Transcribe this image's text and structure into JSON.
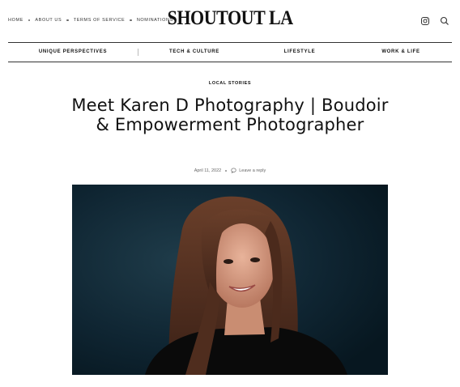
{
  "topnav": {
    "items": [
      "HOME",
      "ABOUT US",
      "TERMS OF SERVICE",
      "NOMINATIONS"
    ]
  },
  "logo": {
    "text": "SHOUTOUT LA"
  },
  "icons": {
    "social": "instagram-icon",
    "search": "search-icon",
    "comment": "comment-icon"
  },
  "mainnav": {
    "items": [
      "UNIQUE PERSPECTIVES",
      "TECH & CULTURE",
      "LIFESTYLE",
      "WORK & LIFE"
    ]
  },
  "article": {
    "category": "LOCAL STORIES",
    "title": "Meet Karen D Photography | Boudoir & Empowerment Photographer",
    "date": "April 11, 2022",
    "reply": "Leave a reply"
  },
  "colors": {
    "text": "#111111",
    "photo_bg": "#0f2430",
    "rule": "#333333"
  }
}
